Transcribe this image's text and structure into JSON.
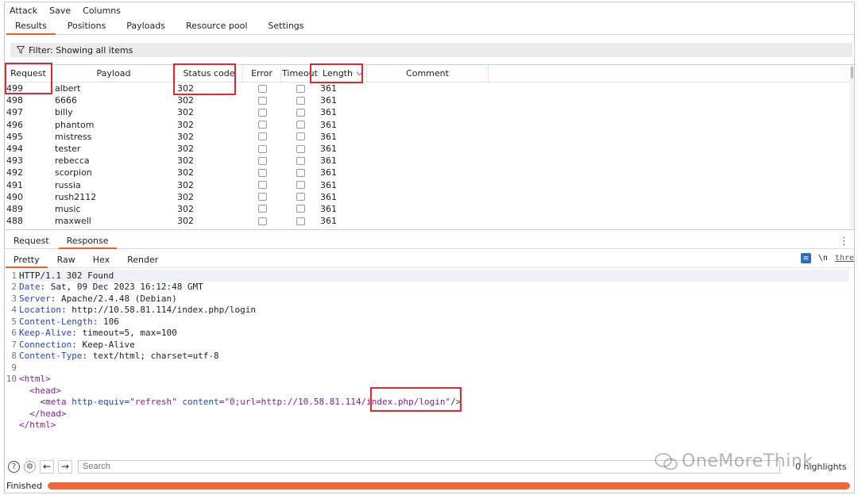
{
  "menu": [
    "Attack",
    "Save",
    "Columns"
  ],
  "main_tabs": [
    {
      "label": "Results",
      "active": true
    },
    {
      "label": "Positions",
      "active": false
    },
    {
      "label": "Payloads",
      "active": false
    },
    {
      "label": "Resource pool",
      "active": false
    },
    {
      "label": "Settings",
      "active": false
    }
  ],
  "filter": {
    "label": "Filter: Showing all items"
  },
  "table": {
    "columns": {
      "request": "Request",
      "payload": "Payload",
      "status": "Status code",
      "error": "Error",
      "timeout": "Timeout",
      "length": "Length",
      "comment": "Comment"
    },
    "rows": [
      {
        "req": "499",
        "payload": "albert",
        "status": "302",
        "length": "361"
      },
      {
        "req": "498",
        "payload": "6666",
        "status": "302",
        "length": "361"
      },
      {
        "req": "497",
        "payload": "billy",
        "status": "302",
        "length": "361"
      },
      {
        "req": "496",
        "payload": "phantom",
        "status": "302",
        "length": "361"
      },
      {
        "req": "495",
        "payload": "mistress",
        "status": "302",
        "length": "361"
      },
      {
        "req": "494",
        "payload": "tester",
        "status": "302",
        "length": "361"
      },
      {
        "req": "493",
        "payload": "rebecca",
        "status": "302",
        "length": "361"
      },
      {
        "req": "492",
        "payload": "scorpion",
        "status": "302",
        "length": "361"
      },
      {
        "req": "491",
        "payload": "russia",
        "status": "302",
        "length": "361"
      },
      {
        "req": "490",
        "payload": "rush2112",
        "status": "302",
        "length": "361"
      },
      {
        "req": "489",
        "payload": "music",
        "status": "302",
        "length": "361"
      },
      {
        "req": "488",
        "payload": "maxwell",
        "status": "302",
        "length": "361"
      }
    ]
  },
  "detail_tabs": [
    {
      "label": "Request",
      "active": false
    },
    {
      "label": "Response",
      "active": true
    }
  ],
  "view_tabs": [
    {
      "label": "Pretty",
      "active": true
    },
    {
      "label": "Raw",
      "active": false
    },
    {
      "label": "Hex",
      "active": false
    },
    {
      "label": "Render",
      "active": false
    }
  ],
  "view_tools": {
    "newline": "\\n",
    "thre": "thre"
  },
  "response": {
    "status_line": "HTTP/1.1 302 Found",
    "headers": [
      {
        "name": "Date",
        "value": "Sat, 09 Dec 2023 16:12:48 GMT"
      },
      {
        "name": "Server",
        "value": "Apache/2.4.48 (Debian)"
      },
      {
        "name": "Location",
        "value": "http://10.58.81.114/index.php/login"
      },
      {
        "name": "Content-Length",
        "value": "106"
      },
      {
        "name": "Keep-Alive",
        "value": "timeout=5, max=100"
      },
      {
        "name": "Connection",
        "value": "Keep-Alive"
      },
      {
        "name": "Content-Type",
        "value": "text/html; charset=utf-8"
      }
    ],
    "body": {
      "html_open": "<html>",
      "head_open": "<head>",
      "meta_tag": "meta",
      "meta_attr1": "http-equiv",
      "meta_val1": "\"refresh\"",
      "meta_attr2": "content",
      "meta_val2_a": "\"0;url=http://10.58.81.114",
      "meta_val2_b": "/index.php/login\"",
      "meta_close": "/>",
      "head_close": "</head>",
      "html_close": "</html>"
    },
    "line_numbers": [
      "1",
      "2",
      "3",
      "4",
      "5",
      "6",
      "7",
      "8",
      "9",
      "10"
    ]
  },
  "search": {
    "placeholder": "Search",
    "highlights": "0 highlights"
  },
  "status": {
    "label": "Finished",
    "progress": 1.0
  },
  "watermark": "OneMoreThink",
  "accent_color": "#e8612c",
  "highlight_color": "#e0282e"
}
